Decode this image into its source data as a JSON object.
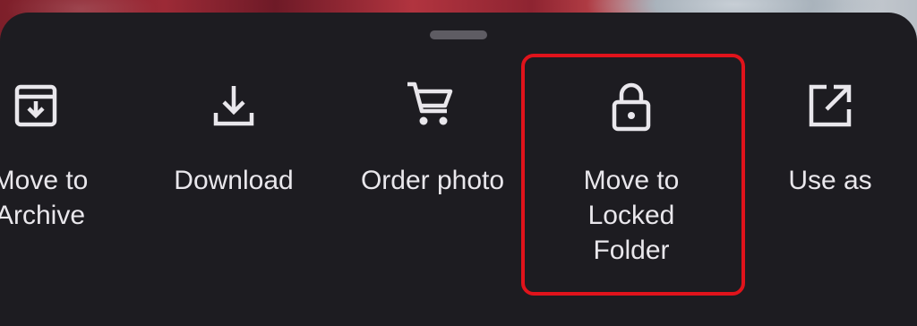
{
  "sheet": {
    "actions": [
      {
        "id": "archive",
        "label": "Move to\nArchive",
        "icon": "archive-icon"
      },
      {
        "id": "download",
        "label": "Download",
        "icon": "download-icon"
      },
      {
        "id": "order",
        "label": "Order photo",
        "icon": "shopping-cart-icon"
      },
      {
        "id": "locked",
        "label": "Move to\nLocked\nFolder",
        "icon": "lock-icon"
      },
      {
        "id": "useas",
        "label": "Use as",
        "icon": "open-external-icon"
      }
    ]
  },
  "colors": {
    "sheet_background": "#1d1c21",
    "text": "#e9e7ec",
    "highlight_border": "#e0131b",
    "handle": "#5e5c63"
  }
}
